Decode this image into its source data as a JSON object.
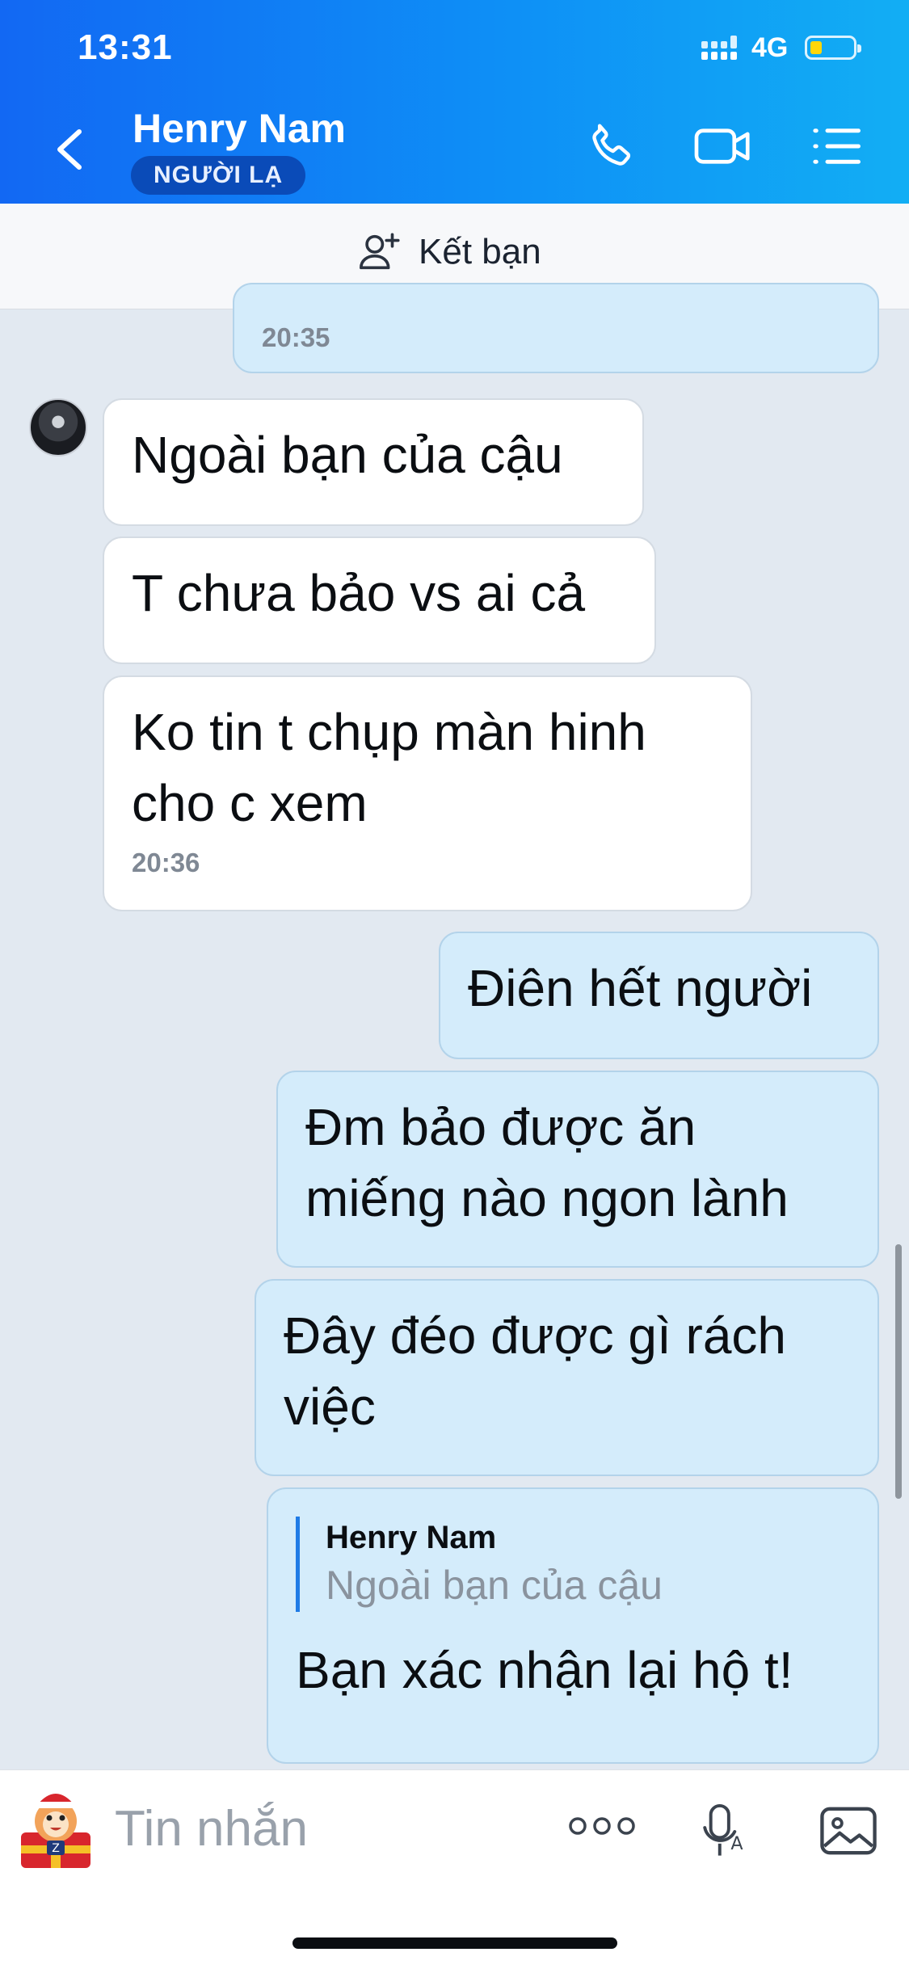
{
  "status_bar": {
    "time": "13:31",
    "network": "4G"
  },
  "header": {
    "contact_name": "Henry Nam",
    "badge": "NGƯỜI LẠ"
  },
  "add_friend": {
    "label": "Kết bạn"
  },
  "messages": [
    {
      "direction": "outgoing",
      "text": "",
      "time": "20:35"
    },
    {
      "direction": "incoming",
      "text": "Ngoài bạn của cậu"
    },
    {
      "direction": "incoming",
      "text": "T chưa bảo vs ai cả"
    },
    {
      "direction": "incoming",
      "text": "Ko tin t chụp màn hinh cho c xem",
      "time": "20:36"
    },
    {
      "direction": "outgoing",
      "text": "Điên hết người"
    },
    {
      "direction": "outgoing",
      "text": "Đm bảo được ăn miếng nào ngon lành"
    },
    {
      "direction": "outgoing",
      "text": "Đây đéo được gì rách việc"
    },
    {
      "direction": "outgoing",
      "quote": {
        "name": "Henry Nam",
        "text": "Ngoài bạn của cậu"
      },
      "text": "Bạn xác nhận lại hộ t!"
    }
  ],
  "composer": {
    "placeholder": "Tin nhắn"
  },
  "colors": {
    "header_gradient_start": "#1268f3",
    "header_gradient_end": "#12aef4",
    "outgoing_bubble": "#d4ecfb",
    "incoming_bubble": "#ffffff",
    "chat_background": "#e2e9f1"
  }
}
